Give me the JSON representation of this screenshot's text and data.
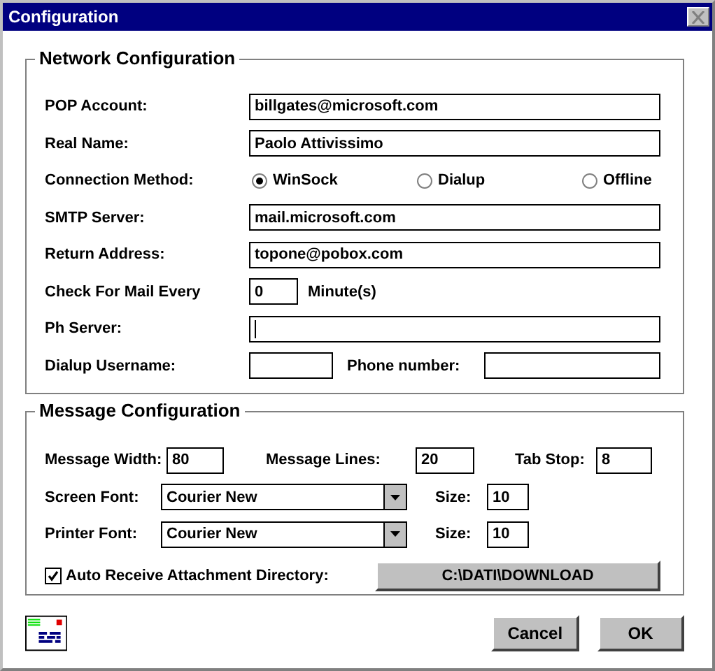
{
  "window": {
    "title": "Configuration"
  },
  "network": {
    "title": "Network Configuration",
    "rows": [
      {
        "kind": "text",
        "label": "POP Account:",
        "value": "billgates@microsoft.com"
      },
      {
        "kind": "text",
        "label": "Real Name:",
        "value": "Paolo Attivissimo"
      },
      {
        "kind": "radio",
        "label": "Connection Method:",
        "options": [
          {
            "label": "WinSock",
            "selected": true
          },
          {
            "label": "Dialup",
            "selected": false
          },
          {
            "label": "Offline",
            "selected": false
          }
        ]
      },
      {
        "kind": "text",
        "label": "SMTP Server:",
        "value": "mail.microsoft.com"
      },
      {
        "kind": "text",
        "label": "Return Address:",
        "value": "topone@pobox.com"
      },
      {
        "kind": "short",
        "label": "Check For Mail Every",
        "value": "0",
        "unit": "Minute(s)"
      },
      {
        "kind": "text",
        "label": "Ph Server:",
        "focused": true
      },
      {
        "kind": "pair",
        "label": "Dialup Username:",
        "label2": "Phone number:"
      }
    ]
  },
  "message": {
    "title": "Message Configuration",
    "numbers": [
      {
        "label": "Message Width:",
        "value": "80"
      },
      {
        "label": "Message Lines:",
        "value": "20"
      },
      {
        "label": "Tab Stop:",
        "value": "8"
      }
    ],
    "fonts": [
      {
        "label": "Screen Font:",
        "value": "Courier New",
        "size_label": "Size:",
        "size": "10"
      },
      {
        "label": "Printer Font:",
        "value": "Courier New",
        "size_label": "Size:",
        "size": "10"
      }
    ],
    "attachment": {
      "label": "Auto Receive Attachment Directory:",
      "checked": true,
      "button": "C:\\DATI\\DOWNLOAD"
    }
  },
  "buttons": [
    {
      "label": "Cancel"
    },
    {
      "label": "OK"
    }
  ]
}
